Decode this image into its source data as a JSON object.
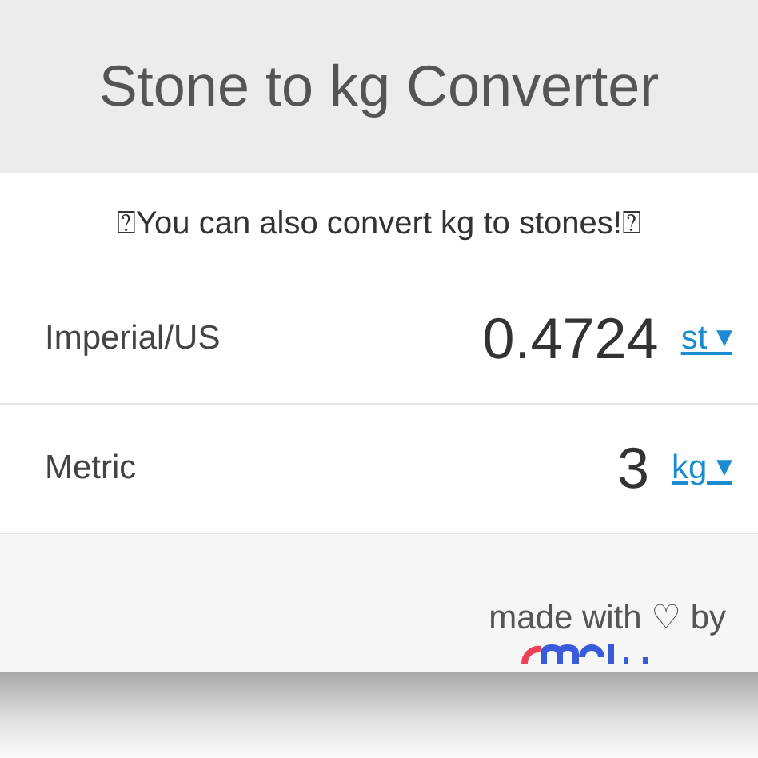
{
  "header": {
    "title": "Stone to kg Converter"
  },
  "notice": "⍰You can also convert kg to stones!⍰",
  "rows": [
    {
      "label": "Imperial/US",
      "value": "0.4724",
      "unit": "st",
      "caret": "▼"
    },
    {
      "label": "Metric",
      "value": "3",
      "unit": "kg",
      "caret": "▼"
    }
  ],
  "footer": {
    "text": "made with ♡ by"
  }
}
